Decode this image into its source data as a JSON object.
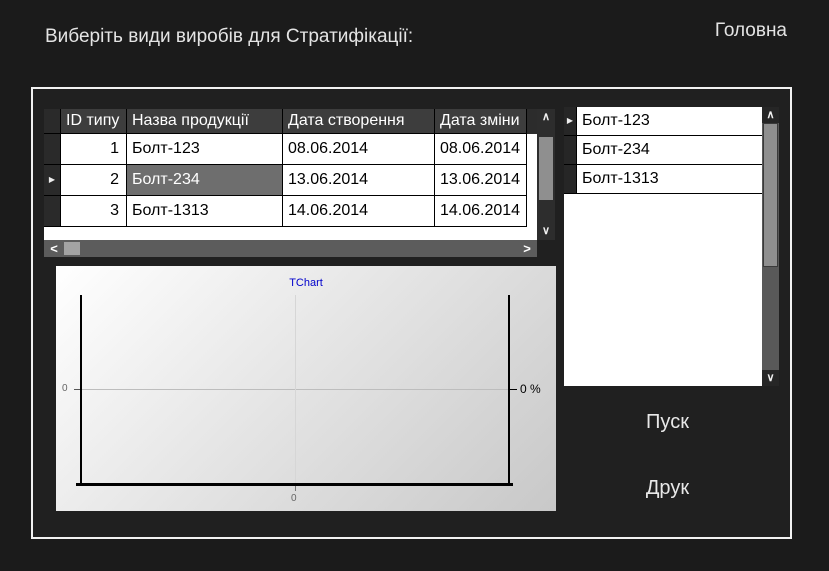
{
  "header": {
    "title": "Виберіть види виробів для Стратифікації:",
    "home": "Головна"
  },
  "products_grid": {
    "columns": [
      "ID типу",
      "Назва продукції",
      "Дата створення",
      "Дата зміни"
    ],
    "rows": [
      {
        "id": "1",
        "name": "Болт-123",
        "created": "08.06.2014",
        "modified": "08.06.2014"
      },
      {
        "id": "2",
        "name": "Болт-234",
        "created": "13.06.2014",
        "modified": "13.06.2014"
      },
      {
        "id": "3",
        "name": "Болт-1313",
        "created": "14.06.2014",
        "modified": "14.06.2014"
      }
    ],
    "selected_row": "2",
    "selected_cell_value": "Болт-234"
  },
  "selection_list": {
    "items": [
      "Болт-123",
      "Болт-234",
      "Болт-1313"
    ],
    "current_item": "Болт-123"
  },
  "chart_data": {
    "type": "line",
    "title": "TChart",
    "series": [],
    "axes": {
      "left": {
        "tick_labels": [
          "0"
        ]
      },
      "right": {
        "tick_labels": [
          "0 %"
        ]
      },
      "bottom": {
        "tick_labels": [
          "0"
        ]
      }
    },
    "grid": "on",
    "legend": "off"
  },
  "buttons": {
    "start": "Пуск",
    "print": "Друк"
  },
  "icons": {
    "row_marker": "▶",
    "scroll_up": "∧",
    "scroll_down": "∨",
    "scroll_left": "<",
    "scroll_right": ">"
  },
  "colors": {
    "selection": "#6e6e6e",
    "chart_title": "#0000cc",
    "panel_border": "#f2f2f2",
    "grid_header": "#3d3d3d"
  }
}
